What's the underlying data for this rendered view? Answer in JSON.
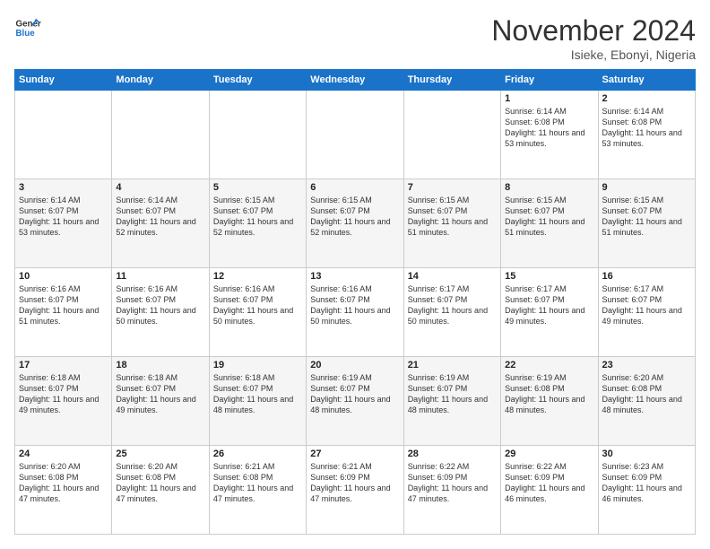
{
  "logo": {
    "line1": "General",
    "line2": "Blue"
  },
  "header": {
    "title": "November 2024",
    "location": "Isieke, Ebonyi, Nigeria"
  },
  "weekdays": [
    "Sunday",
    "Monday",
    "Tuesday",
    "Wednesday",
    "Thursday",
    "Friday",
    "Saturday"
  ],
  "weeks": [
    [
      {
        "day": "",
        "info": ""
      },
      {
        "day": "",
        "info": ""
      },
      {
        "day": "",
        "info": ""
      },
      {
        "day": "",
        "info": ""
      },
      {
        "day": "",
        "info": ""
      },
      {
        "day": "1",
        "info": "Sunrise: 6:14 AM\nSunset: 6:08 PM\nDaylight: 11 hours\nand 53 minutes."
      },
      {
        "day": "2",
        "info": "Sunrise: 6:14 AM\nSunset: 6:08 PM\nDaylight: 11 hours\nand 53 minutes."
      }
    ],
    [
      {
        "day": "3",
        "info": "Sunrise: 6:14 AM\nSunset: 6:07 PM\nDaylight: 11 hours\nand 53 minutes."
      },
      {
        "day": "4",
        "info": "Sunrise: 6:14 AM\nSunset: 6:07 PM\nDaylight: 11 hours\nand 52 minutes."
      },
      {
        "day": "5",
        "info": "Sunrise: 6:15 AM\nSunset: 6:07 PM\nDaylight: 11 hours\nand 52 minutes."
      },
      {
        "day": "6",
        "info": "Sunrise: 6:15 AM\nSunset: 6:07 PM\nDaylight: 11 hours\nand 52 minutes."
      },
      {
        "day": "7",
        "info": "Sunrise: 6:15 AM\nSunset: 6:07 PM\nDaylight: 11 hours\nand 51 minutes."
      },
      {
        "day": "8",
        "info": "Sunrise: 6:15 AM\nSunset: 6:07 PM\nDaylight: 11 hours\nand 51 minutes."
      },
      {
        "day": "9",
        "info": "Sunrise: 6:15 AM\nSunset: 6:07 PM\nDaylight: 11 hours\nand 51 minutes."
      }
    ],
    [
      {
        "day": "10",
        "info": "Sunrise: 6:16 AM\nSunset: 6:07 PM\nDaylight: 11 hours\nand 51 minutes."
      },
      {
        "day": "11",
        "info": "Sunrise: 6:16 AM\nSunset: 6:07 PM\nDaylight: 11 hours\nand 50 minutes."
      },
      {
        "day": "12",
        "info": "Sunrise: 6:16 AM\nSunset: 6:07 PM\nDaylight: 11 hours\nand 50 minutes."
      },
      {
        "day": "13",
        "info": "Sunrise: 6:16 AM\nSunset: 6:07 PM\nDaylight: 11 hours\nand 50 minutes."
      },
      {
        "day": "14",
        "info": "Sunrise: 6:17 AM\nSunset: 6:07 PM\nDaylight: 11 hours\nand 50 minutes."
      },
      {
        "day": "15",
        "info": "Sunrise: 6:17 AM\nSunset: 6:07 PM\nDaylight: 11 hours\nand 49 minutes."
      },
      {
        "day": "16",
        "info": "Sunrise: 6:17 AM\nSunset: 6:07 PM\nDaylight: 11 hours\nand 49 minutes."
      }
    ],
    [
      {
        "day": "17",
        "info": "Sunrise: 6:18 AM\nSunset: 6:07 PM\nDaylight: 11 hours\nand 49 minutes."
      },
      {
        "day": "18",
        "info": "Sunrise: 6:18 AM\nSunset: 6:07 PM\nDaylight: 11 hours\nand 49 minutes."
      },
      {
        "day": "19",
        "info": "Sunrise: 6:18 AM\nSunset: 6:07 PM\nDaylight: 11 hours\nand 48 minutes."
      },
      {
        "day": "20",
        "info": "Sunrise: 6:19 AM\nSunset: 6:07 PM\nDaylight: 11 hours\nand 48 minutes."
      },
      {
        "day": "21",
        "info": "Sunrise: 6:19 AM\nSunset: 6:07 PM\nDaylight: 11 hours\nand 48 minutes."
      },
      {
        "day": "22",
        "info": "Sunrise: 6:19 AM\nSunset: 6:08 PM\nDaylight: 11 hours\nand 48 minutes."
      },
      {
        "day": "23",
        "info": "Sunrise: 6:20 AM\nSunset: 6:08 PM\nDaylight: 11 hours\nand 48 minutes."
      }
    ],
    [
      {
        "day": "24",
        "info": "Sunrise: 6:20 AM\nSunset: 6:08 PM\nDaylight: 11 hours\nand 47 minutes."
      },
      {
        "day": "25",
        "info": "Sunrise: 6:20 AM\nSunset: 6:08 PM\nDaylight: 11 hours\nand 47 minutes."
      },
      {
        "day": "26",
        "info": "Sunrise: 6:21 AM\nSunset: 6:08 PM\nDaylight: 11 hours\nand 47 minutes."
      },
      {
        "day": "27",
        "info": "Sunrise: 6:21 AM\nSunset: 6:09 PM\nDaylight: 11 hours\nand 47 minutes."
      },
      {
        "day": "28",
        "info": "Sunrise: 6:22 AM\nSunset: 6:09 PM\nDaylight: 11 hours\nand 47 minutes."
      },
      {
        "day": "29",
        "info": "Sunrise: 6:22 AM\nSunset: 6:09 PM\nDaylight: 11 hours\nand 46 minutes."
      },
      {
        "day": "30",
        "info": "Sunrise: 6:23 AM\nSunset: 6:09 PM\nDaylight: 11 hours\nand 46 minutes."
      }
    ]
  ]
}
